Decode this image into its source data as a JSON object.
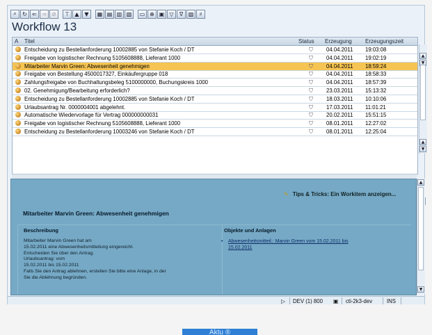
{
  "toolbar": {
    "icons": [
      "find-icon",
      "refresh-icon",
      "back-icon",
      "forward-icon",
      "stop-icon",
      "filter-icon",
      "sort-up-icon",
      "sort-down-icon",
      "layout-icon",
      "details-icon",
      "grid-icon",
      "columns-icon",
      "print-icon",
      "find-next-icon",
      "view-icon",
      "settings-icon",
      "filter2-icon",
      "chart-icon",
      "binoculars-icon"
    ]
  },
  "window": {
    "title": "Workflow 13"
  },
  "table": {
    "headers": {
      "icon": "A",
      "title": "Titel",
      "status": "Status",
      "erzeugung": "Erzeugung",
      "erzeugungszeit": "Erzeugungszeit"
    },
    "rows": [
      {
        "title": "Entscheidung zu Bestellanforderung 10002885 von Stefanie Koch / DT",
        "date": "04.04.2011",
        "time": "19:03:08",
        "selected": false
      },
      {
        "title": "Freigabe von logistischer Rechnung 5105608888, Lieferant 1000",
        "date": "04.04.2011",
        "time": "19:02:19",
        "selected": false
      },
      {
        "title": "Mitarbeiter Marvin Green: Abwesenheit genehmigen",
        "date": "04.04.2011",
        "time": "18:59:24",
        "selected": true
      },
      {
        "title": "Freigabe von Bestellung 4500017327, Einkäufergruppe 018",
        "date": "04.04.2011",
        "time": "18:58:33",
        "selected": false
      },
      {
        "title": "Zahlungsfreigabe von Buchhaltungsbeleg 5100000000, Buchungskreis 1000",
        "date": "04.04.2011",
        "time": "18:57:39",
        "selected": false
      },
      {
        "title": "02. Genehmigung/Bearbeitung erforderlich?",
        "date": "23.03.2011",
        "time": "15:13:32",
        "selected": false
      },
      {
        "title": "Entscheidung zu Bestellanforderung 10002885 von Stefanie Koch / DT",
        "date": "18.03.2011",
        "time": "10:10:06",
        "selected": false
      },
      {
        "title": "Urlaubsantrag  Nr. 0000004001 abgelehnt.",
        "date": "17.03.2011",
        "time": "11:01:21",
        "selected": false
      },
      {
        "title": "Automatische Wiedervorlage für Vertrag 000000000031",
        "date": "20.02.2011",
        "time": "15:51:15",
        "selected": false
      },
      {
        "title": "Freigabe von logistischer Rechnung 5105608888, Lieferant 1000",
        "date": "08.01.2011",
        "time": "12:27:02",
        "selected": false
      },
      {
        "title": "Entscheidung zu Bestellanforderung 10003246 von Stefanie Koch / DT",
        "date": "08.01.2011",
        "time": "12:25:04",
        "selected": false
      }
    ]
  },
  "detail": {
    "tips": "Tips & Tricks:  Ein Workitem anzeigen...",
    "title": "Mitarbeiter Marvin Green: Abwesenheit genehmigen",
    "beschreibung_label": "Beschreibung",
    "beschreibung_lines": [
      "Mitarbeiter Marvin Green hat am",
      "15.02.2011 eine Abwesenheitsmitteilung eingereicht.",
      "Entscheiden Sie über den Antrag.",
      "Urlaubsantrag: vom",
      "15.02.2011 bis 15.02.2011",
      "Falls Sie den Antrag ablehnen, erstellen Sie bitte eine Anlage, in der",
      "Sie die Ablehnung begründen."
    ],
    "objekte_label": "Objekte und Anlagen",
    "objekt_link_line1": "Abwesenheitsmitteil.: Marvin Green vom 15.02.2011 bis",
    "objekt_link_line2": "15.02.2011"
  },
  "statusbar": {
    "system": "DEV (1) 800",
    "server": "cti-2k3-dev",
    "mode": "INS"
  },
  "bottom": {
    "button": "Aktu  ®"
  }
}
